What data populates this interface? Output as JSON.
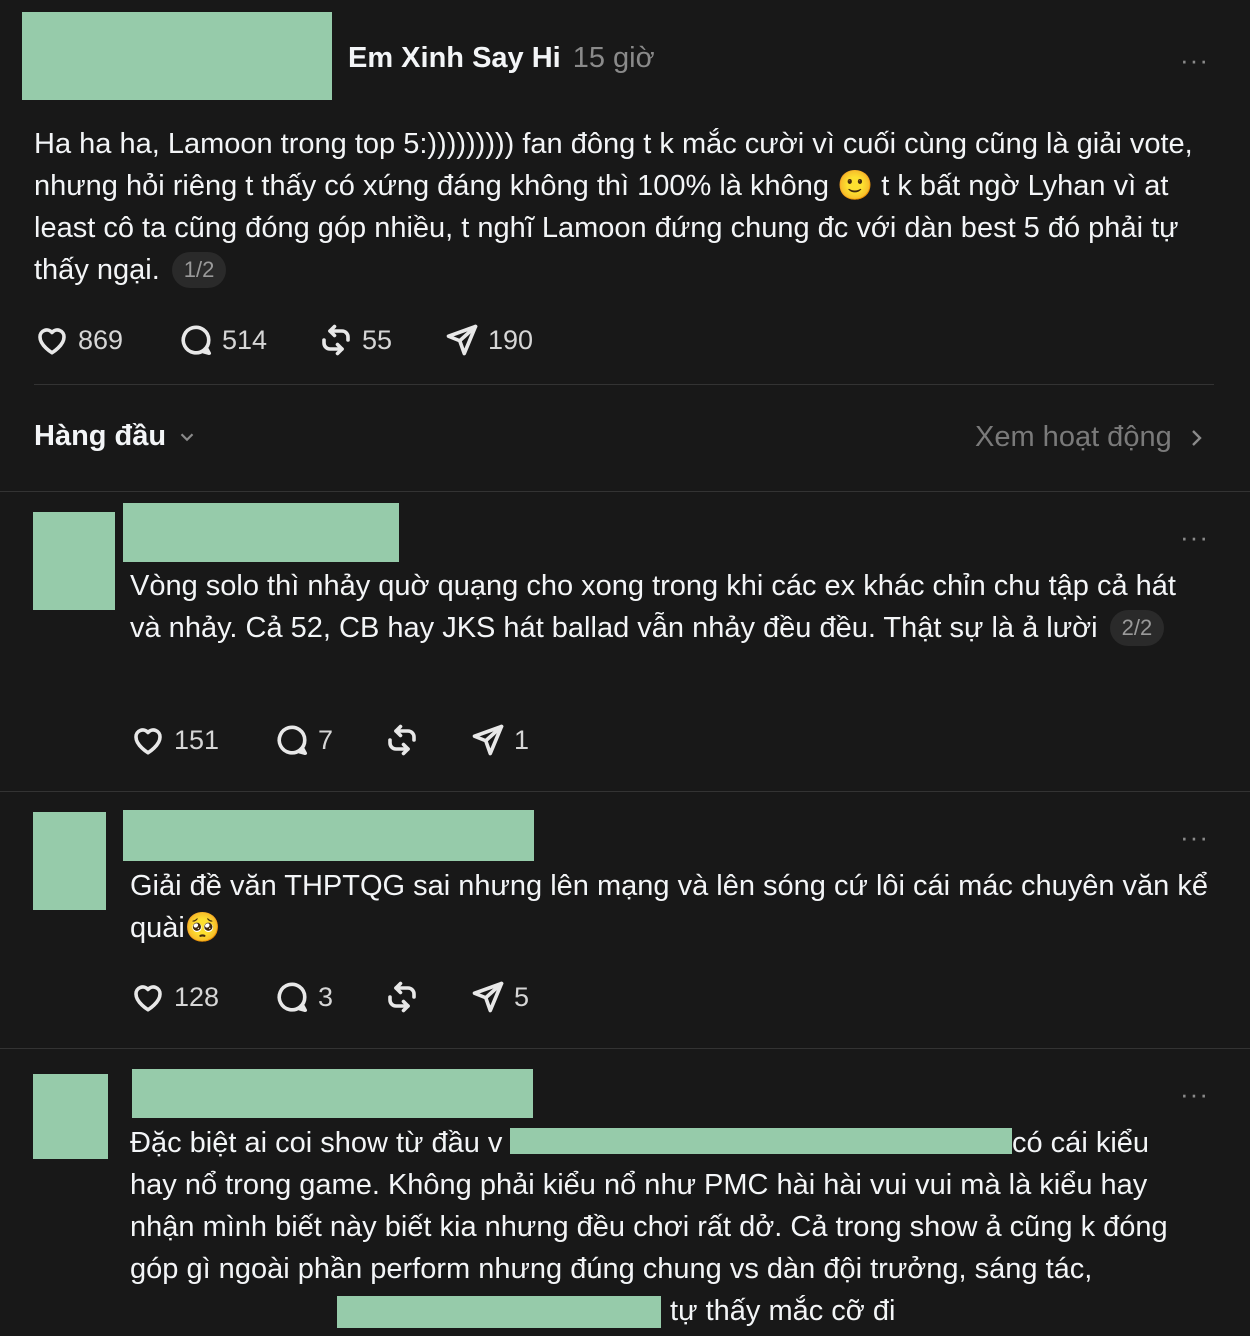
{
  "post": {
    "username": "Em Xinh Say Hi",
    "time": "15 giờ",
    "text": "Ha ha ha, Lamoon trong top 5:))))))))) fan đông t k mắc cười vì cuối cùng cũng là giải vote, nhưng hỏi riêng t thấy có xứng đáng không thì 100% là không 🙂 t k bất ngờ Lyhan vì at least cô ta cũng đóng góp nhiều, t nghĩ Lamoon đứng chung đc với dàn best 5 đó phải tự thấy ngại.",
    "counter": "1/2",
    "likes": "869",
    "comments": "514",
    "reposts": "55",
    "shares": "190",
    "more": "···"
  },
  "sort_bar": {
    "label": "Hàng đầu",
    "activity_link": "Xem hoạt động"
  },
  "replies": [
    {
      "text": "Vòng solo thì nhảy quờ quạng cho xong trong khi các ex khác chỉn chu tập cả hát và nhảy. Cả 52, CB hay JKS hát ballad vẫn nhảy đều đều. Thật sự là ả lười",
      "counter": "2/2",
      "likes": "151",
      "comments": "7",
      "reposts": "",
      "shares": "1",
      "more": "···"
    },
    {
      "text": "Giải đề văn THPTQG sai nhưng lên mạng và lên sóng cứ lôi cái mác chuyên văn kể quài🥺",
      "likes": "128",
      "comments": "3",
      "reposts": "",
      "shares": "5",
      "more": "···"
    },
    {
      "text_part1": "Đặc biệt ai coi show từ đầu v",
      "text_part2": " có cái kiểu",
      "text_part3": "hay nổ trong game. Không phải kiểu nổ như PMC hài hài vui vui mà là kiểu hay nhận mình biết này biết kia nhưng đều chơi rất dở. Cả trong show ả cũng k đóng góp gì ngoài phần perform nhưng đúng chung vs dàn đội trưởng, sáng tác, concept,...",
      "text_part4": " tự thấy mắc cỡ đi",
      "more": "···"
    }
  ]
}
